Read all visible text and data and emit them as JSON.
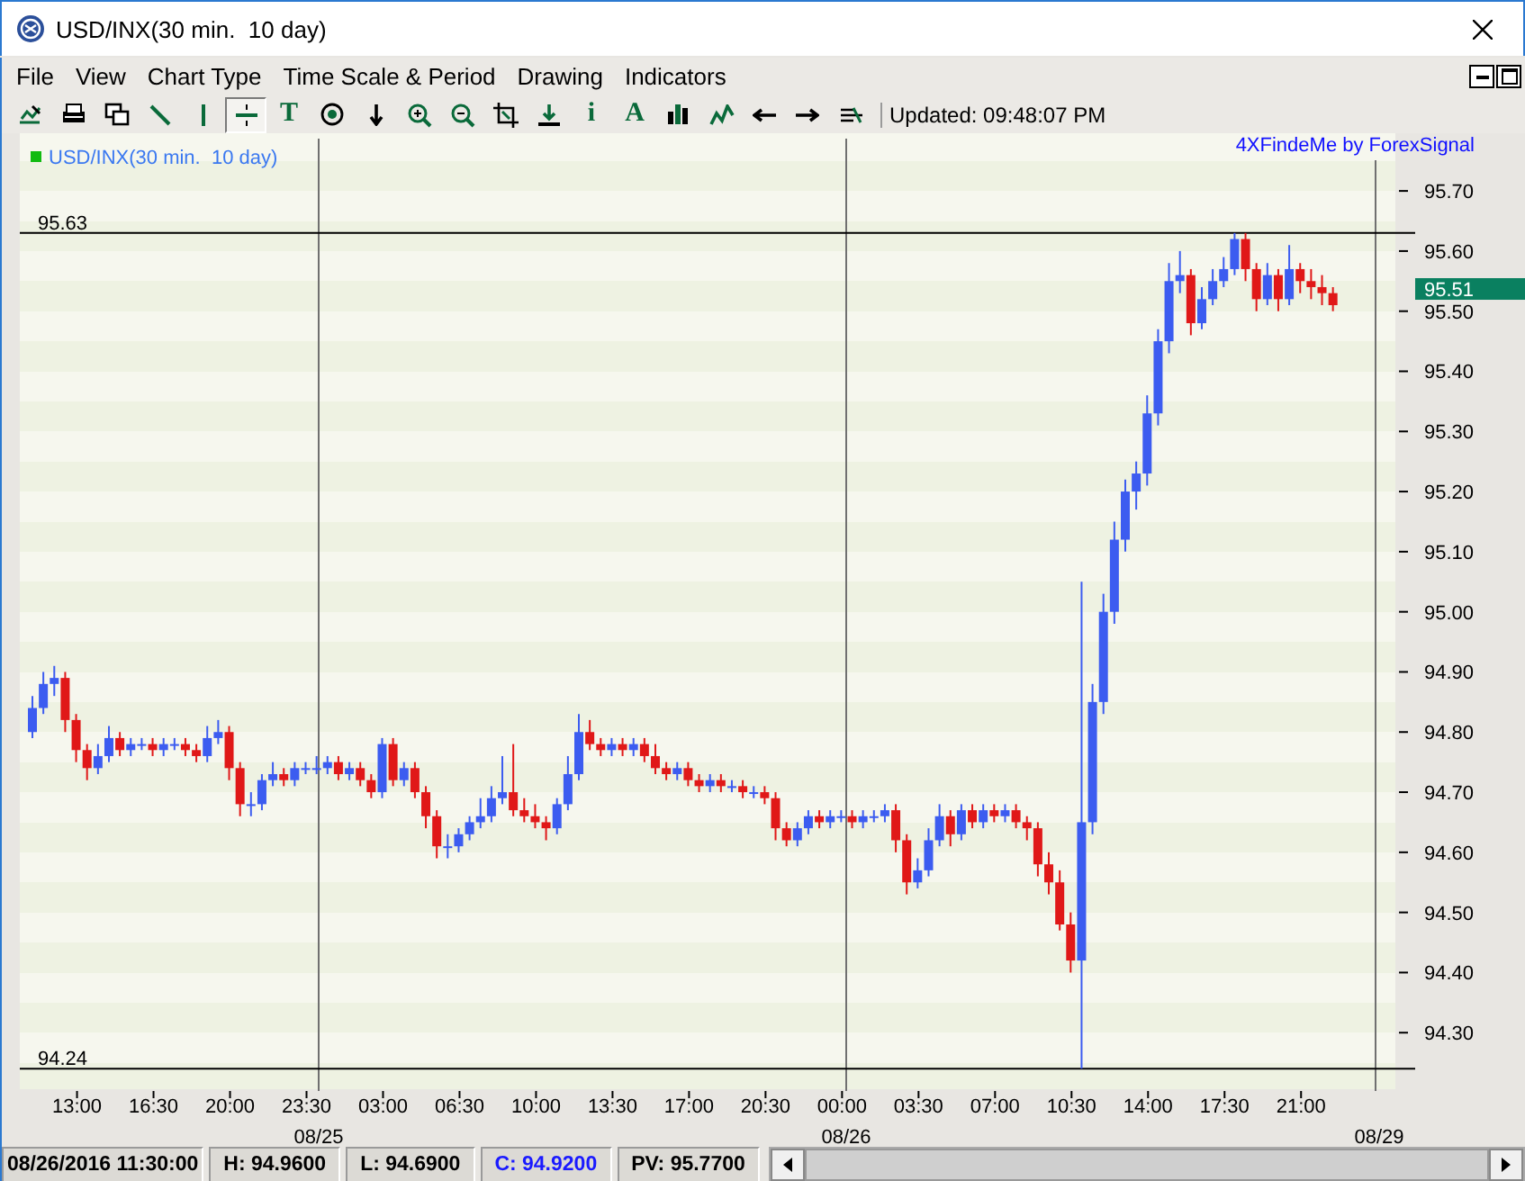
{
  "window": {
    "title": "USD/INX(30 min.  10 day)"
  },
  "menu": [
    "File",
    "View",
    "Chart Type",
    "Time Scale & Period",
    "Drawing",
    "Indicators"
  ],
  "toolbar": {
    "buttons": [
      {
        "kind": "chart-export",
        "selected": false
      },
      {
        "kind": "print",
        "selected": false
      },
      {
        "kind": "windows",
        "selected": false
      },
      {
        "kind": "diagonal-line",
        "selected": false
      },
      {
        "kind": "vertical-line",
        "selected": false
      },
      {
        "kind": "horizontal-line",
        "selected": true
      },
      {
        "kind": "letter",
        "label": "T",
        "selected": false
      },
      {
        "kind": "target",
        "selected": false
      },
      {
        "kind": "down-arrow",
        "selected": false
      },
      {
        "kind": "zoom-in",
        "selected": false
      },
      {
        "kind": "zoom-out",
        "selected": false
      },
      {
        "kind": "crop",
        "selected": false
      },
      {
        "kind": "download",
        "selected": false
      },
      {
        "kind": "letter",
        "label": "i",
        "selected": false
      },
      {
        "kind": "letter",
        "label": "A",
        "selected": false
      },
      {
        "kind": "bars",
        "selected": false
      },
      {
        "kind": "squiggle",
        "selected": false
      },
      {
        "kind": "left-arrow",
        "selected": false
      },
      {
        "kind": "right-arrow",
        "selected": false
      },
      {
        "kind": "strike",
        "selected": false
      }
    ],
    "updated": "Updated: 09:48:07 PM"
  },
  "chart": {
    "legend": "USD/INX(30 min.  10 day)",
    "credit": "4XFindeMe by ForexSignal",
    "last_price": "95.51",
    "dates": [
      "08/25",
      "08/26",
      "08/29"
    ],
    "chart_data": {
      "type": "candlestick",
      "ylim": [
        94.206,
        95.787
      ],
      "categories": [
        null,
        null,
        null,
        null,
        "13:00",
        null,
        null,
        null,
        null,
        null,
        null,
        "16:30",
        null,
        null,
        null,
        null,
        null,
        null,
        "20:00",
        null,
        null,
        null,
        null,
        null,
        null,
        "23:30",
        null,
        null,
        null,
        null,
        null,
        null,
        "03:00",
        null,
        null,
        null,
        null,
        null,
        null,
        "06:30",
        null,
        null,
        null,
        null,
        null,
        null,
        "10:00",
        null,
        null,
        null,
        null,
        null,
        null,
        "13:30",
        null,
        null,
        null,
        null,
        null,
        null,
        "17:00",
        null,
        null,
        null,
        null,
        null,
        null,
        "20:30",
        null,
        null,
        null,
        null,
        null,
        null,
        "00:00",
        null,
        null,
        null,
        null,
        null,
        null,
        "03:30",
        null,
        null,
        null,
        null,
        null,
        null,
        "07:00",
        null,
        null,
        null,
        null,
        null,
        null,
        "10:30",
        null,
        null,
        null,
        null,
        null,
        null,
        "14:00",
        null,
        null,
        null,
        null,
        null,
        null,
        "17:30",
        null,
        null,
        null,
        null,
        null,
        null,
        "21:00",
        null,
        null,
        null
      ],
      "ref_lines": [
        {
          "axis": "y",
          "value": 95.63,
          "label": "95.63"
        },
        {
          "axis": "y",
          "value": 94.24,
          "label": "94.24"
        }
      ],
      "ohlc": [
        [
          94.8,
          94.86,
          94.79,
          94.84
        ],
        [
          94.84,
          94.9,
          94.83,
          94.88
        ],
        [
          94.88,
          94.91,
          94.86,
          94.89
        ],
        [
          94.89,
          94.9,
          94.8,
          94.82
        ],
        [
          94.82,
          94.83,
          94.75,
          94.77
        ],
        [
          94.77,
          94.78,
          94.72,
          94.74
        ],
        [
          94.74,
          94.78,
          94.73,
          94.76
        ],
        [
          94.76,
          94.81,
          94.75,
          94.79
        ],
        [
          94.79,
          94.8,
          94.76,
          94.77
        ],
        [
          94.77,
          94.79,
          94.76,
          94.78
        ],
        [
          94.78,
          94.79,
          94.77,
          94.78
        ],
        [
          94.78,
          94.79,
          94.76,
          94.77
        ],
        [
          94.77,
          94.79,
          94.76,
          94.78
        ],
        [
          94.78,
          94.79,
          94.77,
          94.78
        ],
        [
          94.78,
          94.79,
          94.76,
          94.77
        ],
        [
          94.77,
          94.78,
          94.75,
          94.76
        ],
        [
          94.76,
          94.81,
          94.75,
          94.79
        ],
        [
          94.79,
          94.82,
          94.78,
          94.8
        ],
        [
          94.8,
          94.81,
          94.72,
          94.74
        ],
        [
          94.74,
          94.75,
          94.66,
          94.68
        ],
        [
          94.68,
          94.7,
          94.66,
          94.68
        ],
        [
          94.68,
          94.73,
          94.67,
          94.72
        ],
        [
          94.72,
          94.75,
          94.71,
          94.73
        ],
        [
          94.73,
          94.74,
          94.71,
          94.72
        ],
        [
          94.72,
          94.75,
          94.71,
          94.74
        ],
        [
          94.74,
          94.75,
          94.73,
          94.74
        ],
        [
          94.74,
          94.76,
          94.73,
          94.74
        ],
        [
          94.74,
          94.76,
          94.73,
          94.75
        ],
        [
          94.75,
          94.76,
          94.72,
          94.73
        ],
        [
          94.73,
          94.75,
          94.72,
          94.74
        ],
        [
          94.74,
          94.75,
          94.71,
          94.72
        ],
        [
          94.72,
          94.73,
          94.69,
          94.7
        ],
        [
          94.7,
          94.79,
          94.69,
          94.78
        ],
        [
          94.78,
          94.79,
          94.71,
          94.72
        ],
        [
          94.72,
          94.75,
          94.71,
          94.74
        ],
        [
          94.74,
          94.75,
          94.69,
          94.7
        ],
        [
          94.7,
          94.71,
          94.64,
          94.66
        ],
        [
          94.66,
          94.67,
          94.59,
          94.61
        ],
        [
          94.61,
          94.63,
          94.59,
          94.61
        ],
        [
          94.61,
          94.64,
          94.6,
          94.63
        ],
        [
          94.63,
          94.66,
          94.62,
          94.65
        ],
        [
          94.65,
          94.69,
          94.64,
          94.66
        ],
        [
          94.66,
          94.71,
          94.65,
          94.69
        ],
        [
          94.69,
          94.76,
          94.68,
          94.7
        ],
        [
          94.7,
          94.78,
          94.66,
          94.67
        ],
        [
          94.67,
          94.69,
          94.65,
          94.66
        ],
        [
          94.66,
          94.68,
          94.64,
          94.65
        ],
        [
          94.65,
          94.66,
          94.62,
          94.64
        ],
        [
          94.64,
          94.69,
          94.63,
          94.68
        ],
        [
          94.68,
          94.76,
          94.67,
          94.73
        ],
        [
          94.73,
          94.83,
          94.72,
          94.8
        ],
        [
          94.8,
          94.82,
          94.77,
          94.78
        ],
        [
          94.78,
          94.79,
          94.76,
          94.77
        ],
        [
          94.77,
          94.79,
          94.76,
          94.78
        ],
        [
          94.78,
          94.79,
          94.76,
          94.77
        ],
        [
          94.77,
          94.79,
          94.76,
          94.78
        ],
        [
          94.78,
          94.79,
          94.75,
          94.76
        ],
        [
          94.76,
          94.78,
          94.73,
          94.74
        ],
        [
          94.74,
          94.75,
          94.72,
          94.73
        ],
        [
          94.73,
          94.75,
          94.72,
          94.74
        ],
        [
          94.74,
          94.75,
          94.71,
          94.72
        ],
        [
          94.72,
          94.73,
          94.7,
          94.71
        ],
        [
          94.71,
          94.73,
          94.7,
          94.72
        ],
        [
          94.72,
          94.73,
          94.7,
          94.71
        ],
        [
          94.71,
          94.72,
          94.7,
          94.71
        ],
        [
          94.71,
          94.72,
          94.69,
          94.7
        ],
        [
          94.7,
          94.71,
          94.69,
          94.7
        ],
        [
          94.7,
          94.71,
          94.68,
          94.69
        ],
        [
          94.69,
          94.7,
          94.62,
          94.64
        ],
        [
          94.64,
          94.65,
          94.61,
          94.62
        ],
        [
          94.62,
          94.65,
          94.61,
          94.64
        ],
        [
          94.64,
          94.67,
          94.63,
          94.66
        ],
        [
          94.66,
          94.67,
          94.64,
          94.65
        ],
        [
          94.65,
          94.67,
          94.64,
          94.66
        ],
        [
          94.66,
          94.67,
          94.65,
          94.66
        ],
        [
          94.66,
          94.67,
          94.64,
          94.65
        ],
        [
          94.65,
          94.67,
          94.64,
          94.66
        ],
        [
          94.66,
          94.67,
          94.65,
          94.66
        ],
        [
          94.66,
          94.68,
          94.65,
          94.67
        ],
        [
          94.67,
          94.68,
          94.6,
          94.62
        ],
        [
          94.62,
          94.63,
          94.53,
          94.55
        ],
        [
          94.55,
          94.59,
          94.54,
          94.57
        ],
        [
          94.57,
          94.64,
          94.56,
          94.62
        ],
        [
          94.62,
          94.68,
          94.61,
          94.66
        ],
        [
          94.66,
          94.67,
          94.61,
          94.63
        ],
        [
          94.63,
          94.68,
          94.62,
          94.67
        ],
        [
          94.67,
          94.68,
          94.64,
          94.65
        ],
        [
          94.65,
          94.68,
          94.64,
          94.67
        ],
        [
          94.67,
          94.68,
          94.65,
          94.66
        ],
        [
          94.66,
          94.68,
          94.65,
          94.67
        ],
        [
          94.67,
          94.68,
          94.64,
          94.65
        ],
        [
          94.65,
          94.66,
          94.62,
          94.64
        ],
        [
          94.64,
          94.65,
          94.56,
          94.58
        ],
        [
          94.58,
          94.6,
          94.53,
          94.55
        ],
        [
          94.55,
          94.57,
          94.47,
          94.48
        ],
        [
          94.48,
          94.5,
          94.4,
          94.42
        ],
        [
          94.42,
          95.05,
          94.24,
          94.65
        ],
        [
          94.65,
          94.88,
          94.63,
          94.85
        ],
        [
          94.85,
          95.03,
          94.83,
          95.0
        ],
        [
          95.0,
          95.15,
          94.98,
          95.12
        ],
        [
          95.12,
          95.22,
          95.1,
          95.2
        ],
        [
          95.2,
          95.25,
          95.17,
          95.23
        ],
        [
          95.23,
          95.36,
          95.21,
          95.33
        ],
        [
          95.33,
          95.47,
          95.31,
          95.45
        ],
        [
          95.45,
          95.58,
          95.43,
          95.55
        ],
        [
          95.55,
          95.6,
          95.53,
          95.56
        ],
        [
          95.56,
          95.57,
          95.46,
          95.48
        ],
        [
          95.48,
          95.54,
          95.47,
          95.52
        ],
        [
          95.52,
          95.57,
          95.51,
          95.55
        ],
        [
          95.55,
          95.59,
          95.54,
          95.57
        ],
        [
          95.57,
          95.63,
          95.56,
          95.62
        ],
        [
          95.62,
          95.63,
          95.55,
          95.57
        ],
        [
          95.57,
          95.58,
          95.5,
          95.52
        ],
        [
          95.52,
          95.58,
          95.51,
          95.56
        ],
        [
          95.56,
          95.57,
          95.5,
          95.52
        ],
        [
          95.52,
          95.61,
          95.51,
          95.57
        ],
        [
          95.57,
          95.58,
          95.53,
          95.55
        ],
        [
          95.55,
          95.57,
          95.52,
          95.54
        ],
        [
          95.54,
          95.56,
          95.51,
          95.53
        ],
        [
          95.53,
          95.54,
          95.5,
          95.51
        ]
      ],
      "yticks": [
        {
          "value": 95.7,
          "label": "95.70"
        },
        {
          "value": 95.6,
          "label": "95.60"
        },
        {
          "value": 95.5,
          "label": "95.50"
        },
        {
          "value": 95.4,
          "label": "95.40"
        },
        {
          "value": 95.3,
          "label": "95.30"
        },
        {
          "value": 95.2,
          "label": "95.20"
        },
        {
          "value": 95.1,
          "label": "95.10"
        },
        {
          "value": 95.0,
          "label": "95.00"
        },
        {
          "value": 94.9,
          "label": "94.90"
        },
        {
          "value": 94.8,
          "label": "94.80"
        },
        {
          "value": 94.7,
          "label": "94.70"
        },
        {
          "value": 94.6,
          "label": "94.60"
        },
        {
          "value": 94.5,
          "label": "94.50"
        },
        {
          "value": 94.4,
          "label": "94.40"
        },
        {
          "value": 94.3,
          "label": "94.30"
        }
      ]
    }
  },
  "status_bar": [
    {
      "kind": "time",
      "text": "08/26/2016 11:30:00"
    },
    {
      "kind": "plain",
      "text": "H: 94.9600"
    },
    {
      "kind": "plain",
      "text": "L: 94.6900"
    },
    {
      "kind": "close",
      "text": "C: 94.9200"
    },
    {
      "kind": "plain",
      "text": "PV: 95.7700"
    }
  ]
}
